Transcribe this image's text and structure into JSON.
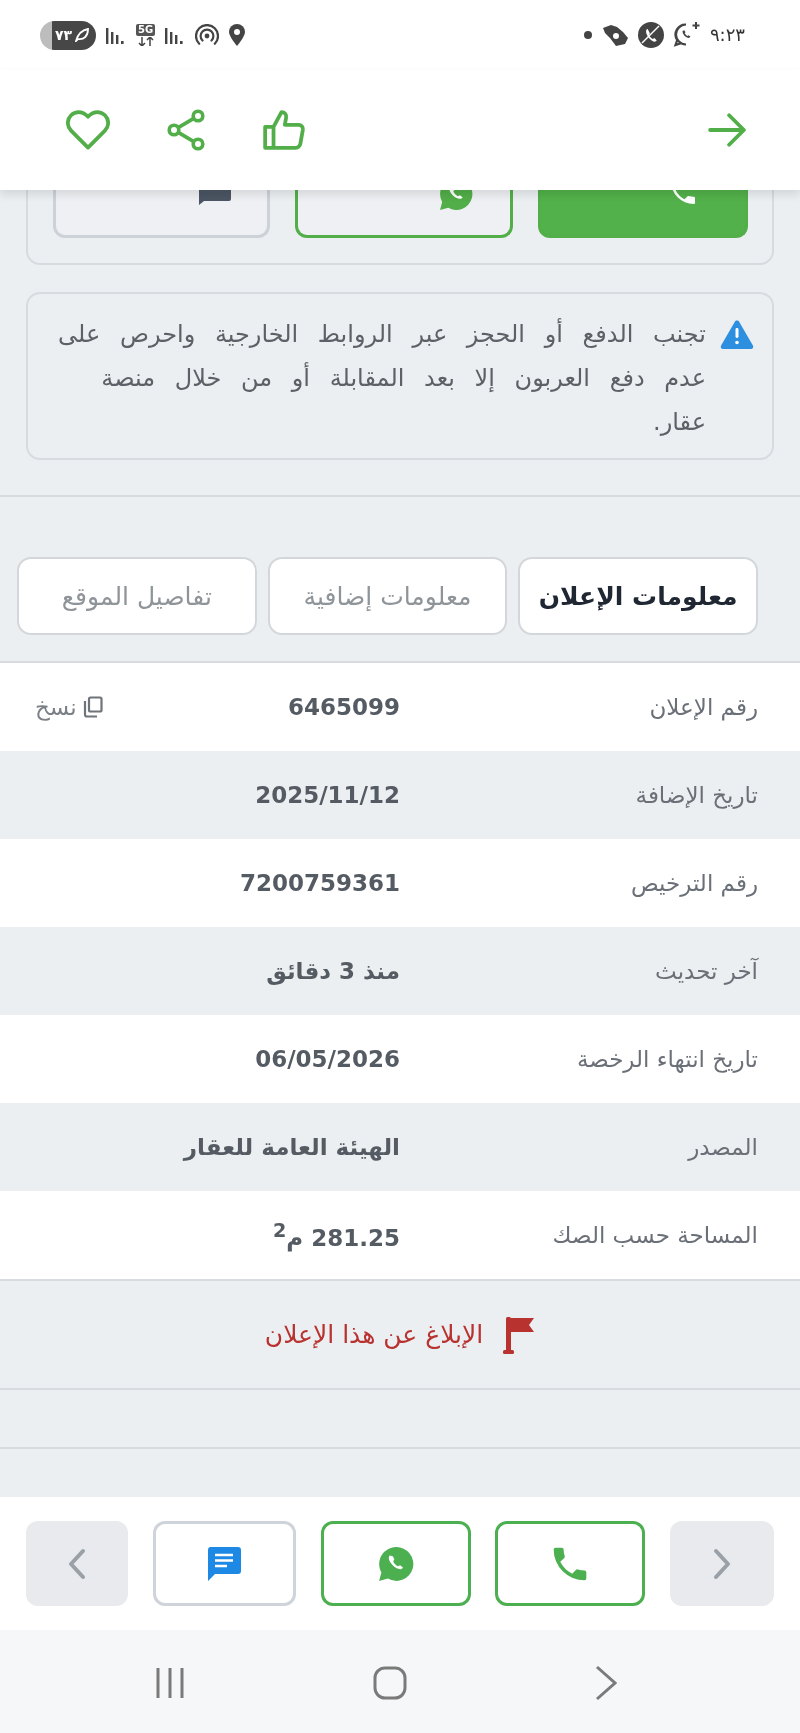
{
  "status_bar": {
    "time": "٩:٢٣",
    "battery": "٧٣",
    "network": "5G"
  },
  "notice": {
    "text": "تجنب الدفع أو الحجز عبر الروابط الخارجية واحرص على عدم دفع العربون إلا بعد المقابلة أو من خلال منصة عقار."
  },
  "tabs": [
    {
      "label": "معلومات الإعلان",
      "selected": true
    },
    {
      "label": "معلومات إضافية",
      "selected": false
    },
    {
      "label": "تفاصيل الموقع",
      "selected": false
    }
  ],
  "details": [
    {
      "label": "رقم الإعلان",
      "value": "6465099",
      "action": "نسخ"
    },
    {
      "label": "تاريخ الإضافة",
      "value": "2025/11/12"
    },
    {
      "label": "رقم الترخيص",
      "value": "7200759361"
    },
    {
      "label": "آخر تحديث",
      "value": "منذ 3 دقائق"
    },
    {
      "label": "تاريخ انتهاء الرخصة",
      "value": "06/05/2026"
    },
    {
      "label": "المصدر",
      "value": "الهيئة العامة للعقار"
    },
    {
      "label": "المساحة حسب الصك",
      "value": "281.25 م$^{2}$"
    }
  ],
  "report": {
    "label": "الإبلاغ عن هذا الإعلان"
  }
}
